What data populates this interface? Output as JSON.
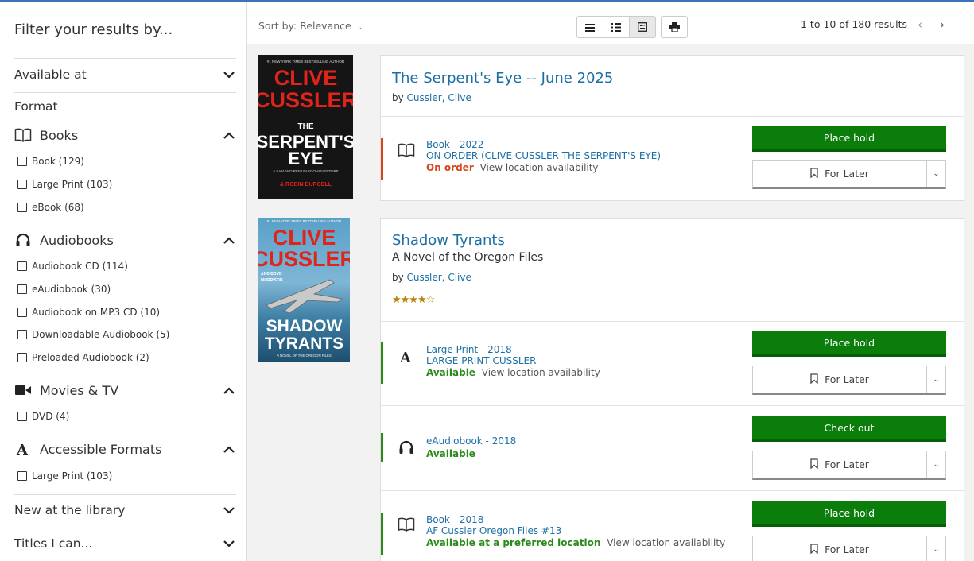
{
  "sidebar": {
    "title": "Filter your results by...",
    "available_at": "Available at",
    "format_label": "Format",
    "groups": [
      {
        "label": "Books",
        "items": [
          "Book (129)",
          "Large Print (103)",
          "eBook (68)"
        ]
      },
      {
        "label": "Audiobooks",
        "items": [
          "Audiobook CD (114)",
          "eAudiobook (30)",
          "Audiobook on MP3 CD (10)",
          "Downloadable Audiobook (5)",
          "Preloaded Audiobook (2)"
        ]
      },
      {
        "label": "Movies & TV",
        "items": [
          "DVD (4)"
        ]
      },
      {
        "label": "Accessible Formats",
        "items": [
          "Large Print (103)"
        ]
      }
    ],
    "new_at_library": "New at the library",
    "titles_i_can": "Titles I can..."
  },
  "toolbar": {
    "sort": "Sort by: Relevance",
    "results_count": "1 to 10 of 180 results",
    "prev": "‹",
    "next": "›"
  },
  "results": [
    {
      "title": "The Serpent's Eye -- June 2025",
      "by": "by",
      "author": "Cussler, Clive",
      "cover": {
        "top": "#1 NEW YORK TIMES BESTSELLING AUTHOR",
        "author1": "CLIVE",
        "author2": "CUSSLER",
        "the": "THE",
        "title1": "SERPENT'S",
        "title2": "EYE",
        "tag": "A SAM AND REMI FARGO ADVENTURE",
        "coauthor": "& ROBIN BURCELL"
      },
      "holdings": [
        {
          "line1": "Book - 2022",
          "line2": "ON ORDER (CLIVE CUSSLER THE SERPENT'S EYE)",
          "status": "On order",
          "view": "View location availability",
          "action": "Place hold",
          "later": "For Later"
        }
      ]
    },
    {
      "title": "Shadow Tyrants",
      "subtitle": "A Novel of the Oregon Files",
      "by": "by",
      "author": "Cussler, Clive",
      "rating": "★★★★☆",
      "cover": {
        "top": "#1 NEW YORK TIMES BESTSELLING AUTHOR",
        "author1": "CLIVE",
        "author2": "CUSSLER",
        "coauthor1": "AND BOYD",
        "coauthor2": "MORRISON",
        "title1": "SHADOW",
        "title2": "TYRANTS",
        "tag": "A NOVEL OF THE OREGON FILES"
      },
      "holdings": [
        {
          "line1": "Large Print - 2018",
          "line2": "LARGE PRINT CUSSLER",
          "status": "Available",
          "view": "View location availability",
          "action": "Place hold",
          "later": "For Later"
        },
        {
          "line1": "eAudiobook - 2018",
          "status": "Available",
          "action": "Check out",
          "later": "For Later"
        },
        {
          "line1": "Book - 2018",
          "line2": "AF Cussler Oregon Files #13",
          "status": "Available at a preferred location",
          "view": "View location availability",
          "action": "Place hold",
          "later": "For Later"
        }
      ]
    }
  ],
  "colors": {
    "accent": "#1c6fa5",
    "green": "#0a7d0a",
    "order": "#d6461d",
    "available": "#2b8a1a"
  },
  "icons": [
    "chevron-down-icon",
    "chevron-up-icon",
    "book-icon",
    "headphones-icon",
    "video-icon",
    "accessible-a-icon",
    "checkbox-icon",
    "list-view-icon",
    "detail-view-icon",
    "grid-view-icon",
    "print-icon",
    "bookmark-icon"
  ]
}
